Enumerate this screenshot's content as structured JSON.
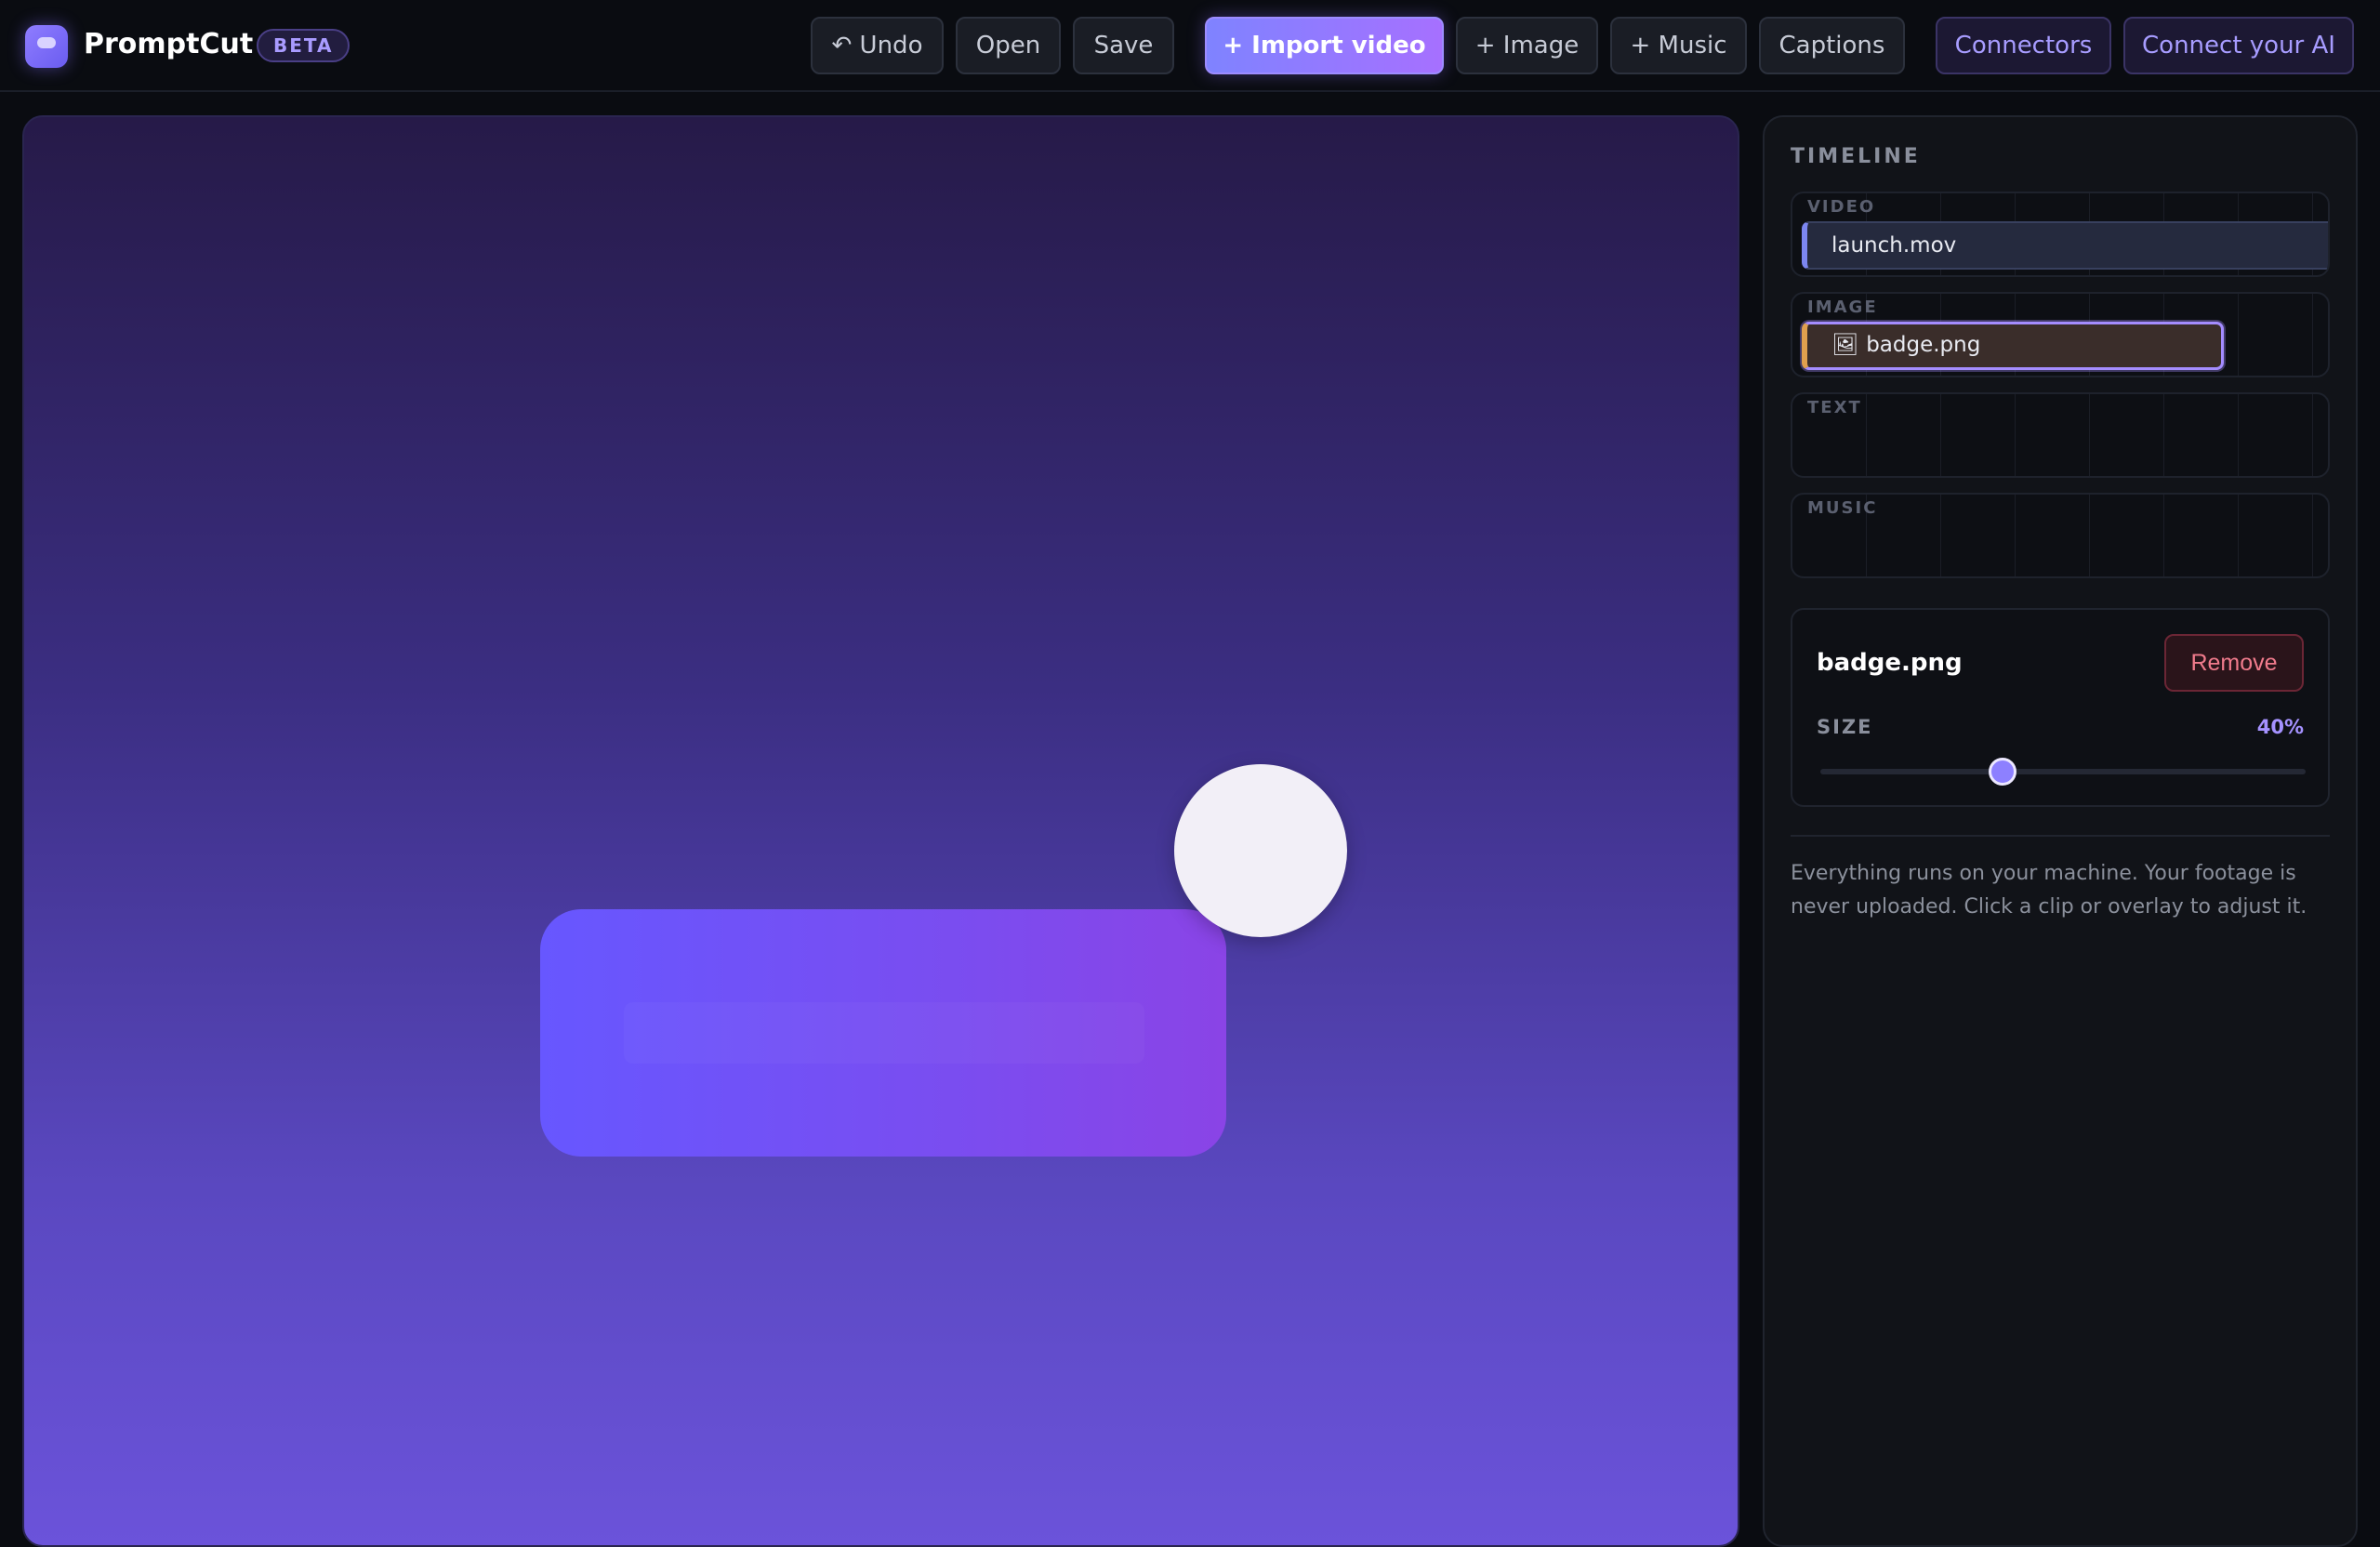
{
  "app": {
    "name": "PromptCut",
    "badge": "BETA"
  },
  "toolbar": {
    "undo": "↶ Undo",
    "open": "Open",
    "save": "Save",
    "import_video": "+ Import video",
    "image": "+ Image",
    "music": "+ Music",
    "captions": "Captions",
    "connectors": "Connectors",
    "connect_ai": "Connect your AI"
  },
  "timeline": {
    "title": "TIMELINE",
    "tracks": [
      {
        "label": "VIDEO",
        "clip": "launch.mov"
      },
      {
        "label": "IMAGE",
        "clip": "badge.png",
        "clip_icon": "🖼"
      },
      {
        "label": "TEXT",
        "clip": ""
      },
      {
        "label": "MUSIC",
        "clip": ""
      }
    ]
  },
  "inspector": {
    "name": "badge.png",
    "remove": "Remove",
    "size_label": "SIZE",
    "size_value": "40%",
    "size_fraction": 0.375
  },
  "help_text": "Everything runs on your machine. Your footage is never uploaded. Click a clip or overlay to adjust it.",
  "colors": {
    "accent": "#8d80ff",
    "danger": "#f07b8c",
    "video_clip": "#7c86f0",
    "image_clip": "#e0a04e"
  }
}
